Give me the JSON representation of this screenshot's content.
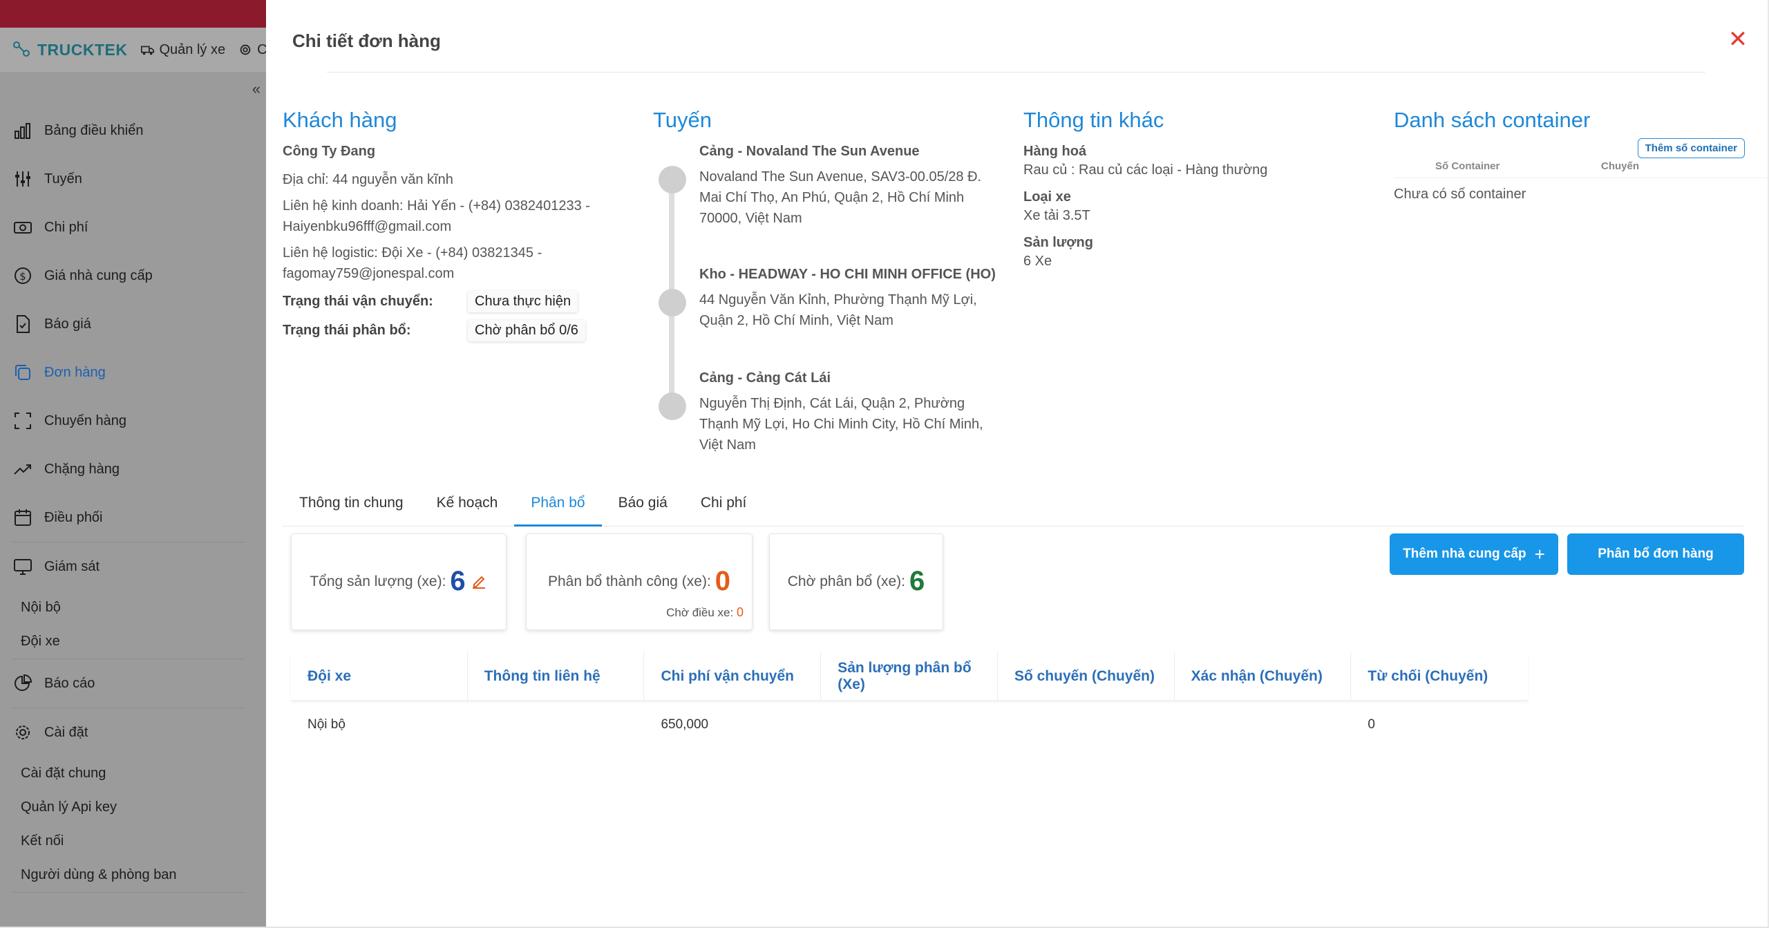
{
  "app": {
    "brand": "TRUCKTEK",
    "header_links": [
      "Quản lý xe",
      "C"
    ]
  },
  "sidebar": {
    "items": [
      {
        "label": "Bảng điều khiển",
        "icon": "bar-chart-icon"
      },
      {
        "label": "Tuyến",
        "icon": "sliders-icon"
      },
      {
        "label": "Chi phí",
        "icon": "cash-icon"
      },
      {
        "label": "Giá nhà cung cấp",
        "icon": "dollar-circle-icon"
      },
      {
        "label": "Báo giá",
        "icon": "document-check-icon"
      },
      {
        "label": "Đơn hàng",
        "icon": "copy-icon",
        "active": true
      },
      {
        "label": "Chuyến hàng",
        "icon": "expand-icon"
      },
      {
        "label": "Chặng hàng",
        "icon": "trend-icon"
      },
      {
        "label": "Điều phối",
        "icon": "calendar-icon"
      }
    ],
    "monitor": {
      "label": "Giám sát",
      "subs": [
        "Nội bộ",
        "Đội xe"
      ]
    },
    "report": {
      "label": "Báo cáo"
    },
    "settings": {
      "label": "Cài đặt",
      "subs": [
        "Cài đặt chung",
        "Quản lý Api key",
        "Kết nối",
        "Người dùng & phòng ban"
      ]
    }
  },
  "modal": {
    "title": "Chi tiết đơn hàng",
    "customer": {
      "title": "Khách hàng",
      "name": "Công Ty Đang",
      "address": "Địa chỉ: 44 nguyễn văn kĩnh",
      "sales_contact": "Liên hệ kinh doanh: Hải Yến - (+84) 0382401233 - Haiyenbku96fff@gmail.com",
      "logistic_contact": "Liên hệ logistic: Đội Xe - (+84) 03821345 - fagomay759@jonespal.com",
      "transport_status_label": "Trạng thái vận chuyển:",
      "transport_status": "Chưa thực hiện",
      "allocation_status_label": "Trạng thái phân bổ:",
      "allocation_status": "Chờ phân bổ 0/6"
    },
    "route": {
      "title": "Tuyến",
      "stops": [
        {
          "name": "Cảng - Novaland The Sun Avenue",
          "address": "Novaland The Sun Avenue, SAV3-00.05/28 Đ. Mai Chí Thọ, An Phú, Quận 2, Hồ Chí Minh 70000, Việt Nam"
        },
        {
          "name": "Kho - HEADWAY - HO CHI MINH OFFICE (HO)",
          "address": "44 Nguyễn Văn Kỉnh, Phường Thạnh Mỹ Lợi, Quận 2, Hồ Chí Minh, Việt Nam"
        },
        {
          "name": "Cảng - Cảng Cát Lái",
          "address": "Nguyễn Thị Định, Cát Lái, Quận 2, Phường Thạnh Mỹ Lợi, Ho Chi Minh City, Hồ Chí Minh, Việt Nam"
        }
      ]
    },
    "other": {
      "title": "Thông tin khác",
      "goods_label": "Hàng hoá",
      "goods": "Rau củ : Rau củ các loại - Hàng thường",
      "vehicle_label": "Loại xe",
      "vehicle": "Xe tải 3.5T",
      "volume_label": "Sản lượng",
      "volume": "6 Xe"
    },
    "containers": {
      "title": "Danh sách container",
      "add_button": "Thêm số container",
      "col_number": "Số Container",
      "col_trip": "Chuyến",
      "empty": "Chưa có số container"
    },
    "tabs": [
      "Thông tin chung",
      "Kế hoạch",
      "Phân bổ",
      "Báo giá",
      "Chi phí"
    ],
    "active_tab": "Phân bổ",
    "stats": {
      "total_label": "Tổng sản lượng (xe):",
      "total_value": "6",
      "success_label": "Phân bổ thành công (xe):",
      "success_value": "0",
      "dispatch_label": "Chờ điều xe:",
      "dispatch_value": "0",
      "pending_label": "Chờ phân bổ (xe):",
      "pending_value": "6"
    },
    "buttons": {
      "add_supplier": "Thêm nhà cung cấp",
      "allocate": "Phân bổ đơn hàng"
    },
    "table": {
      "headers": [
        "Đội xe",
        "Thông tin liên hệ",
        "Chi phí vận chuyển",
        "Sản lượng phân bổ (Xe)",
        "Số chuyến (Chuyến)",
        "Xác nhận (Chuyến)",
        "Từ chối (Chuyến)"
      ],
      "rows": [
        [
          "Nội bộ",
          "",
          "650,000",
          "",
          "",
          "",
          "0"
        ]
      ]
    }
  },
  "colors": {
    "accent": "#1e88d8",
    "button": "#1896e8",
    "success_num": "#e8591a",
    "pending_num": "#1f7a3a",
    "total_num": "#1e4fa8",
    "close": "#e53935"
  }
}
